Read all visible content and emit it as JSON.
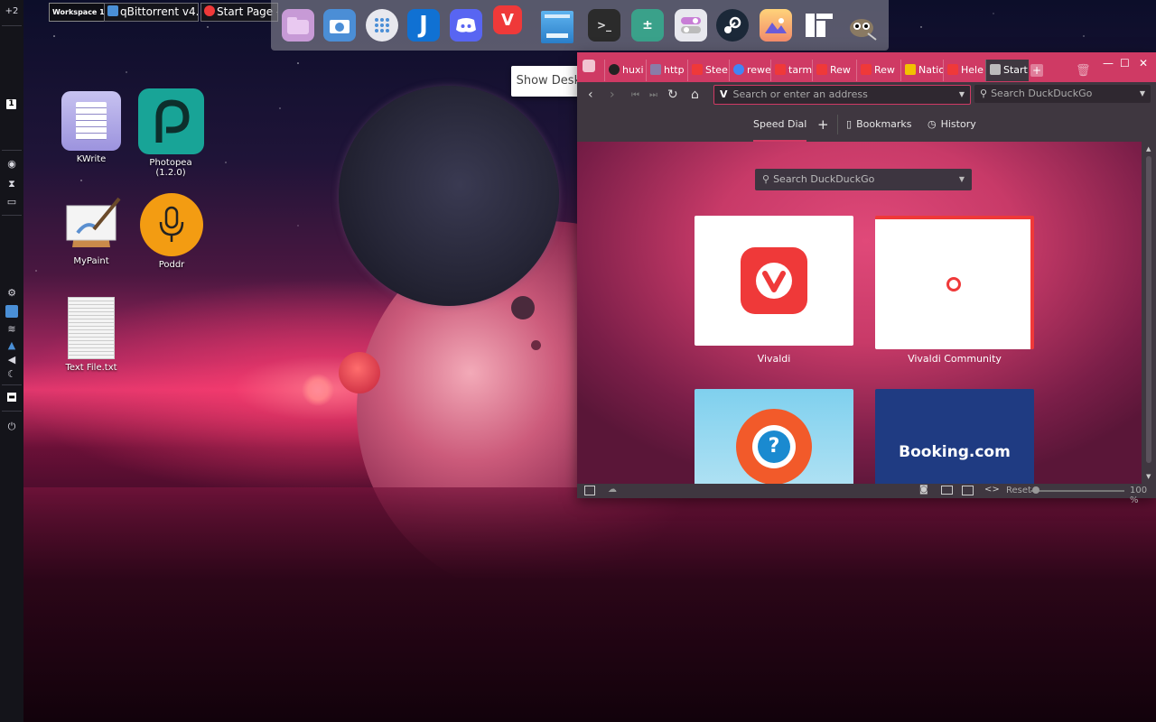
{
  "left_panel": {
    "workspace_count": "+2",
    "active_workspace": "1"
  },
  "taskbar": {
    "workspace_label": "Workspace 1",
    "tasks": [
      {
        "label": "qBittorrent v4..."
      },
      {
        "label": "Start Page - Vi"
      }
    ]
  },
  "dock": {
    "tooltip": "Show Desktop",
    "icons": [
      "files-icon",
      "screenshot-icon",
      "app-grid-icon",
      "joplin-icon",
      "discord-icon",
      "vivaldi-icon",
      "show-desktop-icon",
      "terminal-icon",
      "calculator-icon",
      "settings-toggle-icon",
      "steam-icon",
      "photos-icon",
      "typora-icon",
      "gimp-icon"
    ],
    "colors": {
      "joplin": "#1071d3",
      "discord": "#5865f2",
      "vivaldi": "#ef3939",
      "terminal": "#2b2b2b",
      "calculator": "#3aa18a",
      "steam": "#1b2838"
    }
  },
  "desktop_icons": [
    {
      "label": "KWrite"
    },
    {
      "label": "Photopea (1.2.0)"
    },
    {
      "label": "MyPaint"
    },
    {
      "label": "Poddr"
    },
    {
      "label": "Text File.txt"
    }
  ],
  "browser": {
    "tabs": [
      {
        "label": "huxi",
        "fav": "#222"
      },
      {
        "label": "http",
        "fav": "#8a7ca8"
      },
      {
        "label": "Stee",
        "fav": "#ef3939"
      },
      {
        "label": "rewe",
        "fav": "#4285f4"
      },
      {
        "label": "tarm",
        "fav": "#ef3939"
      },
      {
        "label": "Rew",
        "fav": "#ef3939"
      },
      {
        "label": "Rew",
        "fav": "#ef3939"
      },
      {
        "label": "Natio",
        "fav": "#f2c200"
      },
      {
        "label": "Hele",
        "fav": "#ef3939"
      },
      {
        "label": "Start",
        "fav": "#bbb"
      }
    ],
    "address_placeholder": "Search or enter an address",
    "search_placeholder": "Search DuckDuckGo",
    "speed_dial_nav": {
      "speed_dial": "Speed Dial",
      "add": "+",
      "bookmarks": "Bookmarks",
      "history": "History"
    },
    "inner_search_placeholder": "Search DuckDuckGo",
    "tiles": [
      {
        "label": "Vivaldi"
      },
      {
        "label": "Vivaldi Community"
      },
      {
        "label": ""
      },
      {
        "label": "",
        "text": "Booking.com"
      }
    ],
    "status": {
      "reset": "Reset",
      "zoom": "100 %"
    },
    "accent": "#cf3a64"
  }
}
